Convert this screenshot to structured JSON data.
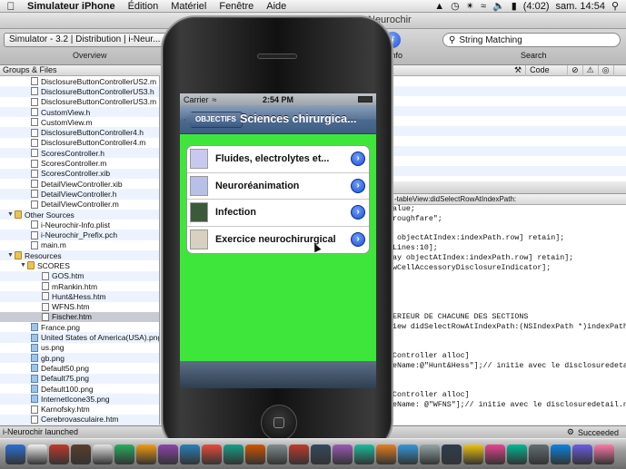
{
  "menubar": {
    "app": "Simulateur iPhone",
    "menus": [
      "Édition",
      "Matériel",
      "Fenêtre",
      "Aide"
    ],
    "battery": "(4:02)",
    "clock": "sam. 14:54"
  },
  "xcode": {
    "window_title": "Neurochir",
    "overview_select": "Simulator - 3.2 | Distribution | i-Neur...",
    "overview_label": "Overview",
    "info_label": "Info",
    "search_placeholder": "String Matching",
    "search_label": "Search",
    "groups_header": "Groups & Files",
    "detail_columns": [
      "Code"
    ],
    "status_left": "i-Neurochir launched",
    "status_right": "Succeeded",
    "editor_path": "-tableView:didSelectRowAtIndexPath:",
    "files": [
      {
        "name": "DisclosureButtonControllerUS2.m",
        "type": "file"
      },
      {
        "name": "DisclosureButtonControllerUS3.h",
        "type": "file"
      },
      {
        "name": "DisclosureButtonControllerUS3.m",
        "type": "file"
      },
      {
        "name": "CustomView.h",
        "type": "file"
      },
      {
        "name": "CustomView.m",
        "type": "file"
      },
      {
        "name": "DisclosureButtonController4.h",
        "type": "file"
      },
      {
        "name": "DisclosureButtonController4.m",
        "type": "file"
      },
      {
        "name": "ScoresController.h",
        "type": "file"
      },
      {
        "name": "ScoresController.m",
        "type": "file"
      },
      {
        "name": "ScoresController.xib",
        "type": "file"
      },
      {
        "name": "DetailViewController.xib",
        "type": "file"
      },
      {
        "name": "DetailViewController.h",
        "type": "file"
      },
      {
        "name": "DetailViewController.m",
        "type": "file"
      },
      {
        "name": "Other Sources",
        "type": "folder"
      },
      {
        "name": "i-Neurochir-Info.plist",
        "type": "file"
      },
      {
        "name": "i-Neurochir_Prefix.pch",
        "type": "file"
      },
      {
        "name": "main.m",
        "type": "file"
      },
      {
        "name": "Resources",
        "type": "folder"
      },
      {
        "name": "SCORES",
        "type": "folder"
      },
      {
        "name": "GOS.htm",
        "type": "file"
      },
      {
        "name": "mRankin.htm",
        "type": "file"
      },
      {
        "name": "Hunt&Hess.htm",
        "type": "file"
      },
      {
        "name": "WFNS.htm",
        "type": "file"
      },
      {
        "name": "Fischer.htm",
        "type": "file"
      },
      {
        "name": "France.png",
        "type": "img"
      },
      {
        "name": "United States of America(USA).png",
        "type": "img"
      },
      {
        "name": "us.png",
        "type": "img"
      },
      {
        "name": "gb.png",
        "type": "img"
      },
      {
        "name": "Default50.png",
        "type": "img"
      },
      {
        "name": "Default75.png",
        "type": "img"
      },
      {
        "name": "Default100.png",
        "type": "img"
      },
      {
        "name": "InternetIcone35.png",
        "type": "img"
      },
      {
        "name": "Karnofsky.htm",
        "type": "file"
      },
      {
        "name": "Cerebrovasculaire.htm",
        "type": "file"
      },
      {
        "name": "Cerebrovasculaire.htm",
        "type": "file"
      }
    ],
    "code": [
      "alue;",
      "roughfare\";",
      "",
      " objectAtIndex:indexPath.row] retain];",
      "Lines:10];",
      "ay objectAtIndex:indexPath.row] retain];",
      "wCellAccessoryDisclosureIndicator];",
      "",
      "",
      "",
      "",
      "ERIEUR DE CHACUNE DES SECTIONS",
      "iew didSelectRowAtIndexPath:(NSIndexPath *)indexPath",
      "",
      "",
      "Controller alloc]",
      "eName:@\"Hunt&Hess\"];// initie avec le disclosuredeta",
      "",
      "",
      "Controller alloc]",
      "eName: @\"WFNS\"];// initie avec le disclosuredetail.n",
      "",
      "",
      "ViewController alloc]"
    ]
  },
  "iphone": {
    "carrier": "Carrier",
    "time": "2:54 PM",
    "back_label": "OBJECTIFS",
    "title": "Sciences chirurgica...",
    "rows": [
      {
        "label": "Fluides, electrolytes et...",
        "thumb_color": "#c9c9f0"
      },
      {
        "label": "Neuroréanimation",
        "thumb_color": "#b8c0e8"
      },
      {
        "label": "Infection",
        "thumb_color": "#3a5a3a"
      },
      {
        "label": "Exercice neurochirurgical",
        "thumb_color": "#d8d0c0"
      }
    ],
    "background_color": "#3ee63c"
  }
}
